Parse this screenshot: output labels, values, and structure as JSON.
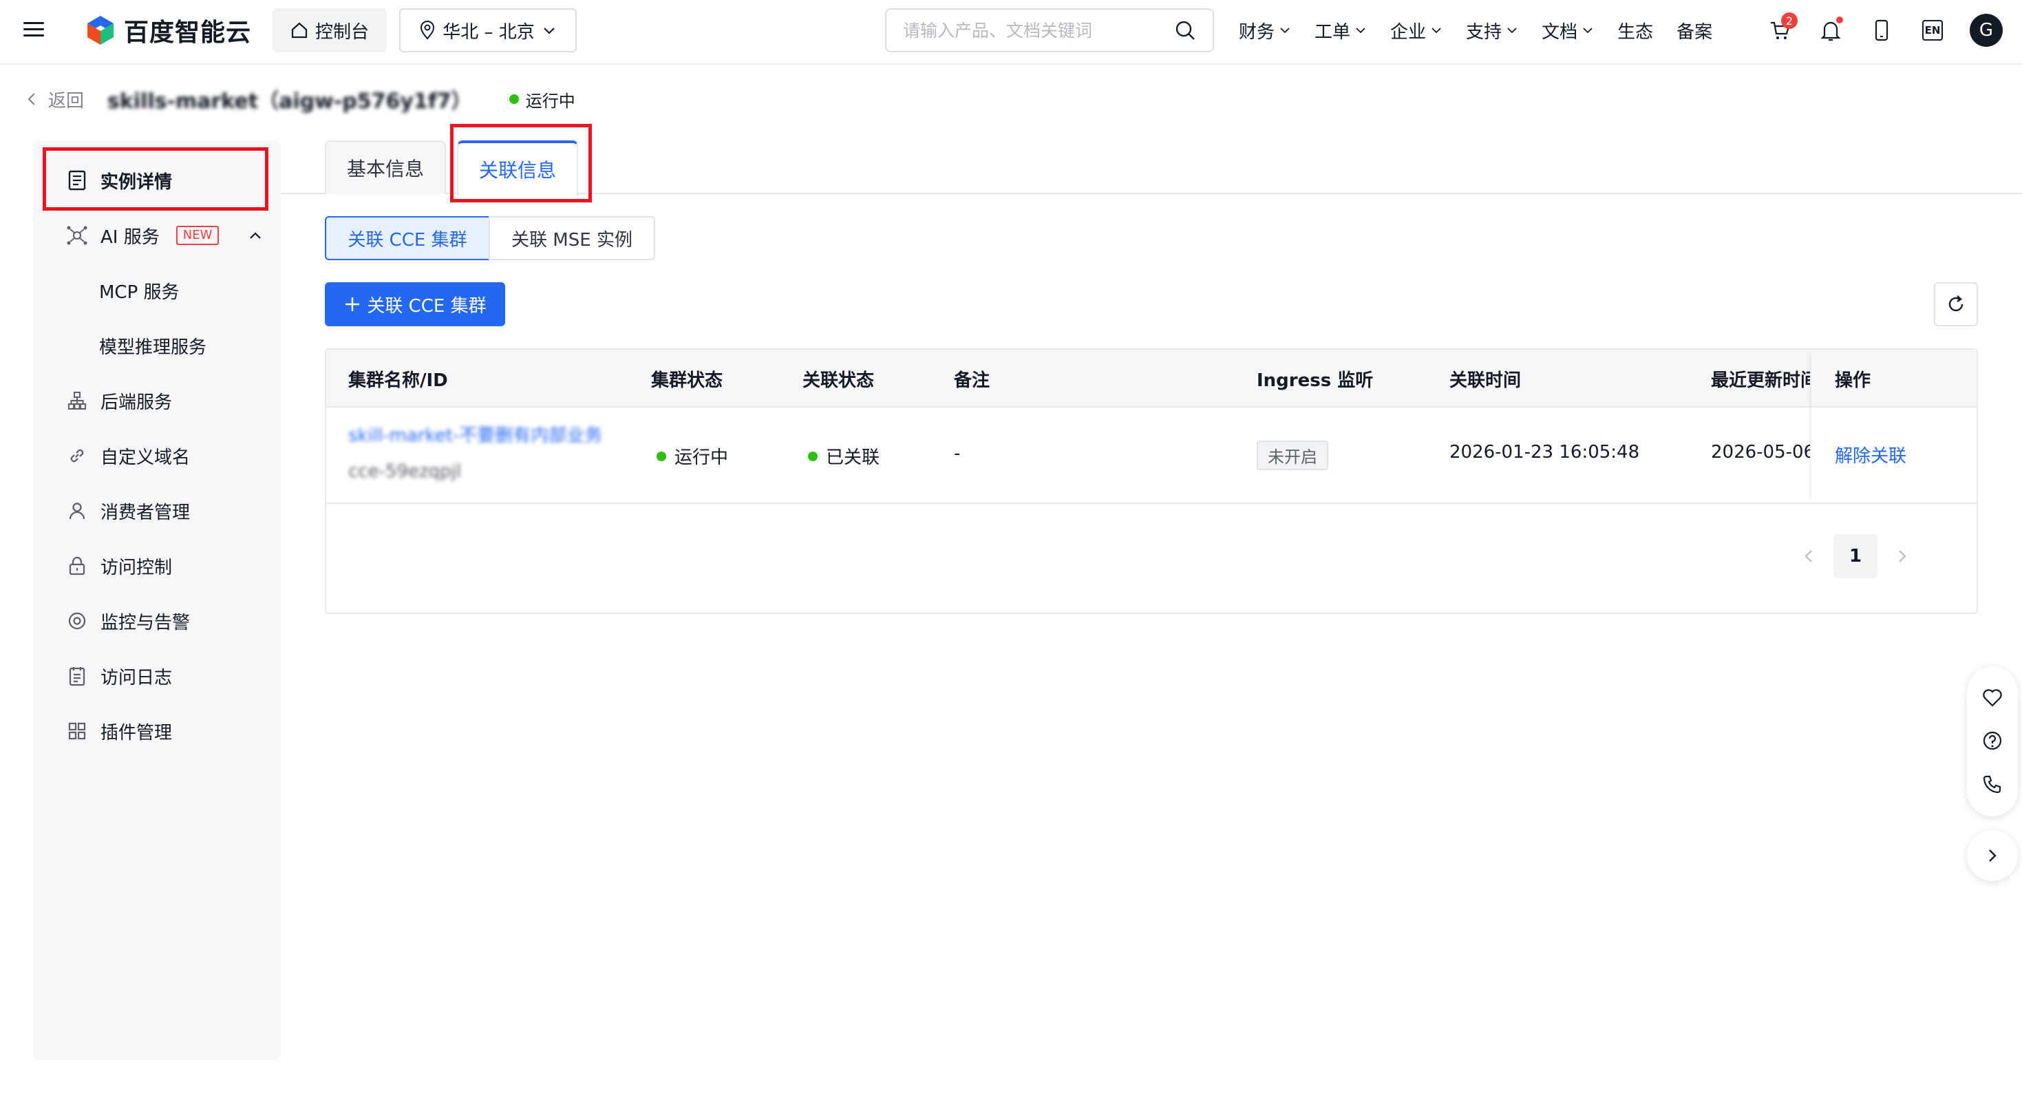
{
  "header": {
    "logo_text": "百度智能云",
    "console_label": "控制台",
    "region_label": "华北 – 北京",
    "search_placeholder": "请输入产品、文档关键词",
    "nav": [
      "财务",
      "工单",
      "企业",
      "支持",
      "文档",
      "生态",
      "备案"
    ],
    "cart_badge": "2",
    "lang_label": "EN",
    "avatar_letter": "G"
  },
  "breadcrumb": {
    "back_label": "返回",
    "instance_title": "skills-market（aigw-p576y1f7）",
    "status": "运行中"
  },
  "sidebar": {
    "items": [
      {
        "label": "实例详情"
      },
      {
        "label": "AI 服务",
        "tag": "NEW"
      },
      {
        "label": "MCP 服务"
      },
      {
        "label": "模型推理服务"
      },
      {
        "label": "后端服务"
      },
      {
        "label": "自定义域名"
      },
      {
        "label": "消费者管理"
      },
      {
        "label": "访问控制"
      },
      {
        "label": "监控与告警"
      },
      {
        "label": "访问日志"
      },
      {
        "label": "插件管理"
      }
    ]
  },
  "tabs": [
    "基本信息",
    "关联信息"
  ],
  "segments": [
    "关联 CCE 集群",
    "关联 MSE 实例"
  ],
  "primary_button": "关联 CCE 集群",
  "table": {
    "headers": [
      "集群名称/ID",
      "集群状态",
      "关联状态",
      "备注",
      "Ingress 监听",
      "关联时间",
      "最近更新时间",
      "操作"
    ],
    "rows": [
      {
        "name": "skill-market-不要删有内部业务",
        "id": "cce-59ezqpjl",
        "cluster_status": "运行中",
        "assoc_status": "已关联",
        "remark": "-",
        "ingress": "未开启",
        "assoc_time": "2026-01-23 16:05:48",
        "update_time": "2026-05-06",
        "action": "解除关联"
      }
    ]
  },
  "pager": {
    "current": "1"
  },
  "colors": {
    "primary": "#2468f2",
    "success": "#30bf13",
    "danger": "#f33e3e",
    "highlight": "#e8141e"
  }
}
